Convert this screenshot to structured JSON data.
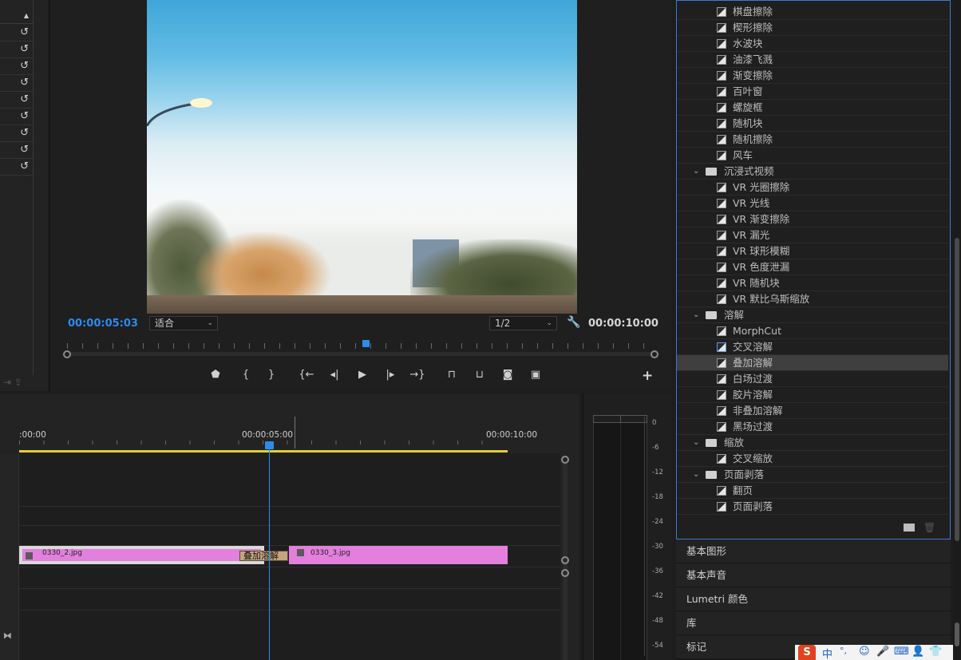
{
  "left_panel": {
    "reset_icons": [
      "reset-icon",
      "reset-icon",
      "reset-icon",
      "reset-icon",
      "reset-icon",
      "reset-icon",
      "reset-icon",
      "reset-icon",
      "reset-icon"
    ],
    "up_arrow": "▲"
  },
  "monitor": {
    "timecode_current": "00:00:05:03",
    "fit_select": "适合",
    "resolution_select": "1/2",
    "timecode_duration": "00:00:10:00",
    "accent_color": "#2d8ceb",
    "controls": [
      "marker",
      "mark-in",
      "mark-out",
      "go-to-in",
      "step-back",
      "play",
      "step-forward",
      "go-to-out",
      "lift",
      "extract",
      "export-frame",
      "compare"
    ]
  },
  "effects": {
    "items": [
      {
        "type": "effect",
        "label": "棋盘擦除"
      },
      {
        "type": "effect",
        "label": "楔形擦除"
      },
      {
        "type": "effect",
        "label": "水波块"
      },
      {
        "type": "effect",
        "label": "油漆飞溅"
      },
      {
        "type": "effect",
        "label": "渐变擦除"
      },
      {
        "type": "effect",
        "label": "百叶窗"
      },
      {
        "type": "effect",
        "label": "螺旋框"
      },
      {
        "type": "effect",
        "label": "随机块"
      },
      {
        "type": "effect",
        "label": "随机擦除"
      },
      {
        "type": "effect",
        "label": "风车"
      },
      {
        "type": "folder",
        "label": "沉浸式视频"
      },
      {
        "type": "effect",
        "label": "VR 光圈擦除"
      },
      {
        "type": "effect",
        "label": "VR 光线"
      },
      {
        "type": "effect",
        "label": "VR 渐变擦除"
      },
      {
        "type": "effect",
        "label": "VR 漏光"
      },
      {
        "type": "effect",
        "label": "VR 球形模糊"
      },
      {
        "type": "effect",
        "label": "VR 色度泄漏"
      },
      {
        "type": "effect",
        "label": "VR 随机块"
      },
      {
        "type": "effect",
        "label": "VR 默比乌斯缩放"
      },
      {
        "type": "folder",
        "label": "溶解"
      },
      {
        "type": "effect",
        "label": "MorphCut"
      },
      {
        "type": "effect",
        "label": "交叉溶解",
        "highlight": true
      },
      {
        "type": "effect",
        "label": "叠加溶解",
        "selected": true
      },
      {
        "type": "effect",
        "label": "白场过渡"
      },
      {
        "type": "effect",
        "label": "胶片溶解"
      },
      {
        "type": "effect",
        "label": "非叠加溶解"
      },
      {
        "type": "effect",
        "label": "黑场过渡"
      },
      {
        "type": "folder",
        "label": "缩放"
      },
      {
        "type": "effect",
        "label": "交叉缩放"
      },
      {
        "type": "folder",
        "label": "页面剥落"
      },
      {
        "type": "effect",
        "label": "翻页"
      },
      {
        "type": "effect",
        "label": "页面剥落"
      }
    ]
  },
  "accordion": [
    "基本图形",
    "基本声音",
    "Lumetri 颜色",
    "库",
    "标记"
  ],
  "timeline": {
    "time_start": ":00:00",
    "time_mid": "00:00:05:00",
    "time_end": "00:00:10:00",
    "clip1": "0330_2.jpg",
    "clip2": "0330_3.jpg",
    "transition": "叠加溶解",
    "clip_color": "#e37fdc"
  },
  "meter": {
    "db_labels": [
      "0",
      "-6",
      "-12",
      "-18",
      "-24",
      "-30",
      "-36",
      "-42",
      "-48",
      "-54"
    ]
  },
  "tray": {
    "ime": "中",
    "punct": "°,"
  }
}
